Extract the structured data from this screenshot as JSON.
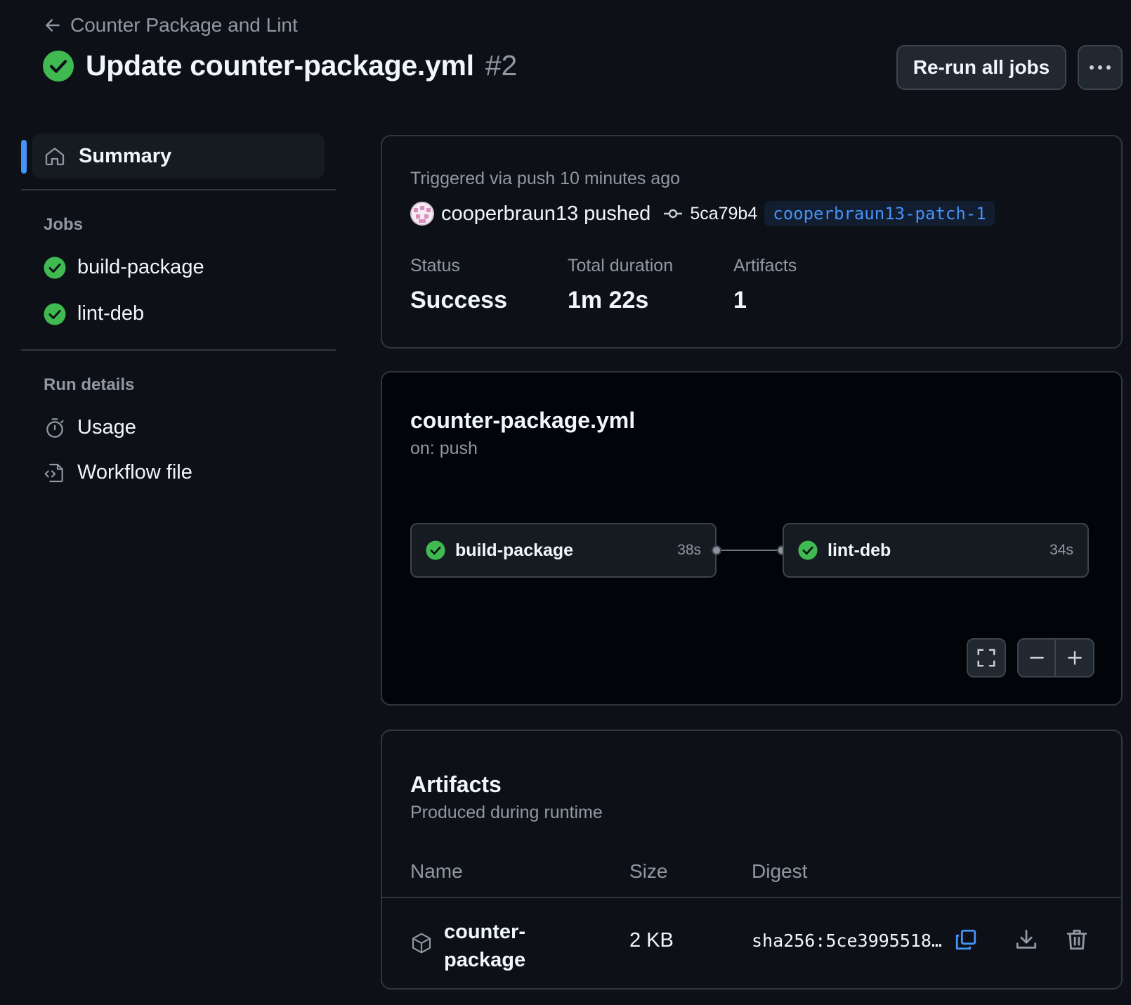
{
  "header": {
    "back_label": "Counter Package and Lint",
    "title": "Update counter-package.yml",
    "run_number": "#2",
    "rerun_label": "Re-run all jobs",
    "more_icon": "kebab-horizontal-icon"
  },
  "sidebar": {
    "summary_label": "Summary",
    "jobs_heading": "Jobs",
    "jobs": [
      {
        "label": "build-package",
        "status": "success"
      },
      {
        "label": "lint-deb",
        "status": "success"
      }
    ],
    "run_details_heading": "Run details",
    "run_details": [
      {
        "label": "Usage",
        "icon": "stopwatch-icon"
      },
      {
        "label": "Workflow file",
        "icon": "file-code-icon"
      }
    ]
  },
  "summary": {
    "triggered": "Triggered via push 10 minutes ago",
    "actor": "cooperbraun13 pushed",
    "commit": "5ca79b4",
    "branch": "cooperbraun13-patch-1",
    "status_label": "Status",
    "status_value": "Success",
    "duration_label": "Total duration",
    "duration_value": "1m 22s",
    "artifacts_label": "Artifacts",
    "artifacts_value": "1"
  },
  "graph": {
    "title": "counter-package.yml",
    "subtitle": "on: push",
    "jobs": [
      {
        "label": "build-package",
        "duration": "38s"
      },
      {
        "label": "lint-deb",
        "duration": "34s"
      }
    ]
  },
  "artifacts": {
    "title": "Artifacts",
    "subtitle": "Produced during runtime",
    "columns": [
      "Name",
      "Size",
      "Digest"
    ],
    "rows": [
      {
        "name": "counter-package",
        "size": "2 KB",
        "digest": "sha256:5ce3995518…"
      }
    ]
  },
  "colors": {
    "success": "#3fb950",
    "accent": "#4493f8",
    "background": "#0d1117"
  }
}
